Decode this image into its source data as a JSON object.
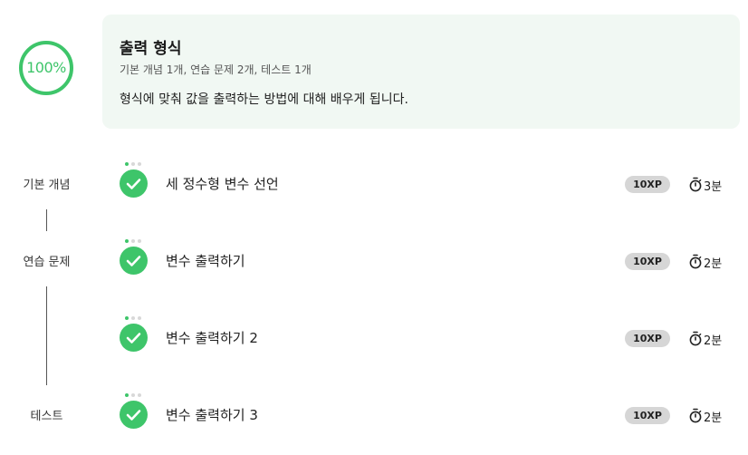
{
  "progress": {
    "percent_text": "100%",
    "value": 1.0,
    "color": "#3ec56a"
  },
  "header": {
    "title": "출력 형식",
    "meta": "기본 개념 1개, 연습 문제 2개, 테스트 1개",
    "description": "형식에 맞춰 값을 출력하는 방법에 대해 배우게 됩니다.",
    "background": "#f1f8f3"
  },
  "sections": [
    {
      "label": "기본 개념"
    },
    {
      "label": "연습 문제"
    },
    {
      "label": "테스트"
    }
  ],
  "lessons": [
    {
      "title": "세 정수형 변수 선언",
      "xp": "10XP",
      "time": "3분",
      "status_icon": "check-icon",
      "timer_icon": "stopwatch-icon"
    },
    {
      "title": "변수 출력하기",
      "xp": "10XP",
      "time": "2분",
      "status_icon": "check-icon",
      "timer_icon": "stopwatch-icon"
    },
    {
      "title": "변수 출력하기 2",
      "xp": "10XP",
      "time": "2분",
      "status_icon": "check-icon",
      "timer_icon": "stopwatch-icon"
    },
    {
      "title": "변수 출력하기 3",
      "xp": "10XP",
      "time": "2분",
      "status_icon": "check-icon",
      "timer_icon": "stopwatch-icon"
    }
  ]
}
